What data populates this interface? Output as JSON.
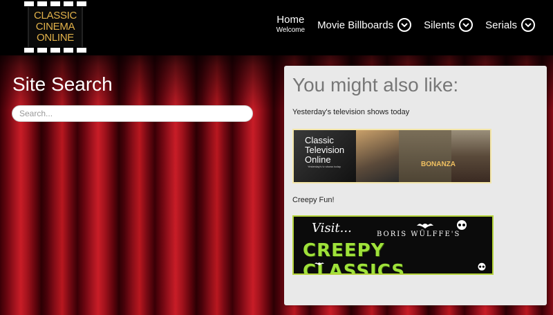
{
  "logo": {
    "lines": [
      "CLASSIC",
      "CINEMA",
      "ONLINE"
    ]
  },
  "nav": {
    "home": {
      "label": "Home",
      "sub": "Welcome"
    },
    "items": [
      {
        "label": "Movie Billboards"
      },
      {
        "label": "Silents"
      },
      {
        "label": "Serials"
      }
    ]
  },
  "search": {
    "title": "Site Search",
    "placeholder": "Search..."
  },
  "sidebar": {
    "title": "You might also like:",
    "promos": [
      {
        "caption": "Yesterday's television shows today",
        "banner_title": "Classic Television Online",
        "banner_tagline": "Yesterday's tv shows today",
        "banner_show": "BONANZA"
      },
      {
        "caption": "Creepy Fun!",
        "banner_visit": "Visit...",
        "banner_host": "BORIS WÜLFFE'S",
        "banner_title": "CREEPY CLASSICS"
      }
    ]
  },
  "colors": {
    "logo_gold": "#e2b24a",
    "panel_bg": "#e9e9e9",
    "curtain_red": "#b8171f",
    "creepy_green": "#9fe23a"
  }
}
